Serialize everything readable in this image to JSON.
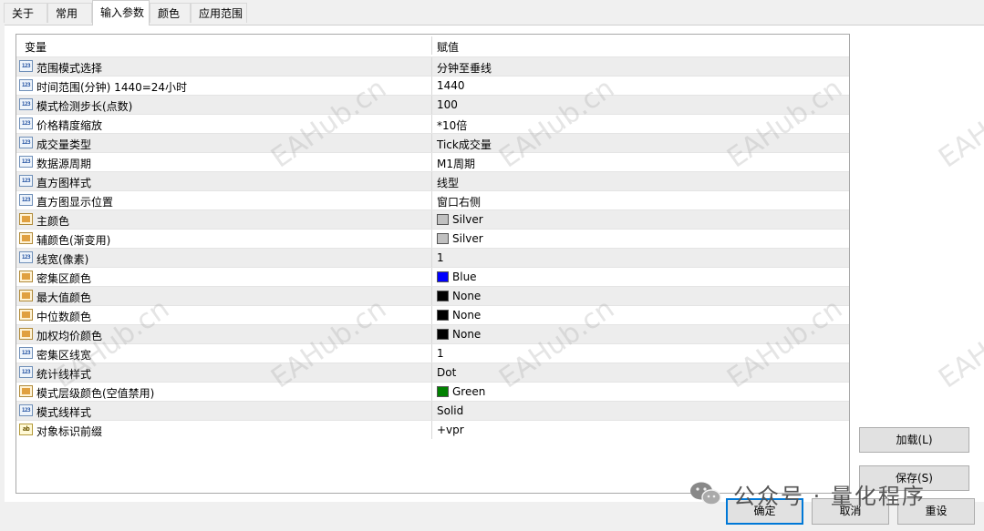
{
  "tabs": [
    "关于",
    "常用",
    "输入参数",
    "颜色",
    "应用范围"
  ],
  "active_tab": 2,
  "grid": {
    "col_variable": "变量",
    "col_value": "赋值",
    "rows": [
      {
        "icon": "123",
        "name": "范围模式选择",
        "value": "分钟至垂线"
      },
      {
        "icon": "123",
        "name": "时间范围(分钟) 1440=24小时",
        "value": "1440"
      },
      {
        "icon": "123",
        "name": "模式检测步长(点数)",
        "value": "100"
      },
      {
        "icon": "123",
        "name": "价格精度缩放",
        "value": "*10倍"
      },
      {
        "icon": "123",
        "name": "成交量类型",
        "value": "Tick成交量"
      },
      {
        "icon": "123",
        "name": "数据源周期",
        "value": "M1周期"
      },
      {
        "icon": "123",
        "name": "直方图样式",
        "value": "线型"
      },
      {
        "icon": "123",
        "name": "直方图显示位置",
        "value": "窗口右侧"
      },
      {
        "icon": "color",
        "name": "主颜色",
        "value": "Silver",
        "swatch": "#c0c0c0"
      },
      {
        "icon": "color",
        "name": "辅颜色(渐变用)",
        "value": "Silver",
        "swatch": "#c0c0c0"
      },
      {
        "icon": "123",
        "name": "线宽(像素)",
        "value": "1"
      },
      {
        "icon": "color",
        "name": "密集区颜色",
        "value": "Blue",
        "swatch": "#0000ff"
      },
      {
        "icon": "color",
        "name": "最大值颜色",
        "value": "None",
        "swatch": "#000000"
      },
      {
        "icon": "color",
        "name": "中位数颜色",
        "value": "None",
        "swatch": "#000000"
      },
      {
        "icon": "color",
        "name": "加权均价颜色",
        "value": "None",
        "swatch": "#000000"
      },
      {
        "icon": "123",
        "name": "密集区线宽",
        "value": "1"
      },
      {
        "icon": "123",
        "name": "统计线样式",
        "value": "Dot"
      },
      {
        "icon": "color",
        "name": "模式层级颜色(空值禁用)",
        "value": "Green",
        "swatch": "#008000"
      },
      {
        "icon": "123",
        "name": "模式线样式",
        "value": "Solid"
      },
      {
        "icon": "ab",
        "name": "对象标识前缀",
        "value": "+vpr"
      }
    ]
  },
  "buttons": {
    "load": "加载(L)",
    "save": "保存(S)",
    "ok": "确定",
    "cancel": "取消",
    "reset": "重设"
  },
  "watermark": {
    "text": "EAHub.cn",
    "wechat_label": "公众号 · 量化程序"
  },
  "icon_labels": {
    "123": "123",
    "color": "",
    "ab": "ab"
  }
}
